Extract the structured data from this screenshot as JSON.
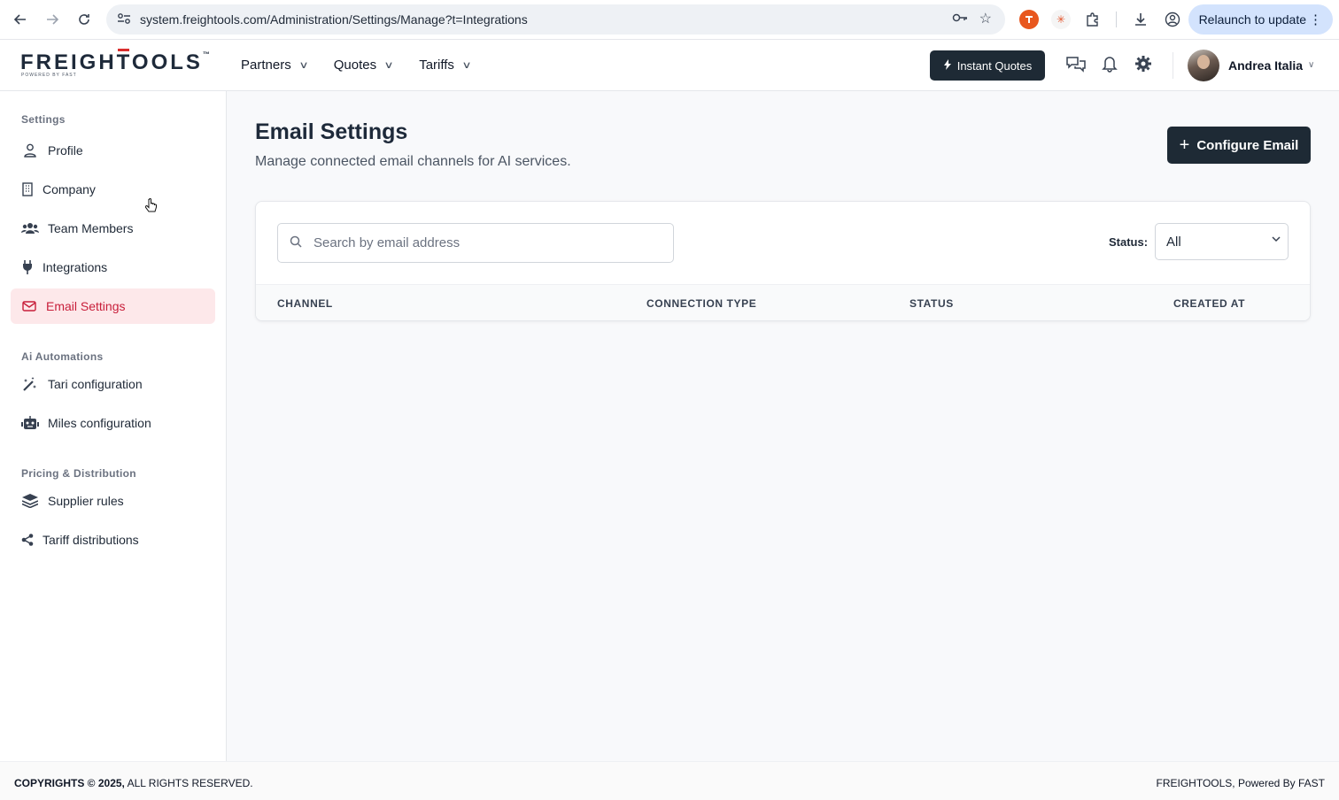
{
  "browser": {
    "url": "system.freightools.com/Administration/Settings/Manage?t=Integrations",
    "relaunch_label": "Relaunch to update"
  },
  "header": {
    "logo_text_a": "FREIGH",
    "logo_text_t": "T",
    "logo_text_b": "OOLS",
    "logo_tm": "™",
    "logo_powered": "POWERED BY FAST",
    "nav": [
      {
        "label": "Partners"
      },
      {
        "label": "Quotes"
      },
      {
        "label": "Tariffs"
      }
    ],
    "instant_quotes_label": "Instant Quotes",
    "user_name": "Andrea Italia"
  },
  "sidebar": {
    "sections": [
      {
        "title": "Settings"
      },
      {
        "title": "Ai Automations"
      },
      {
        "title": "Pricing & Distribution"
      }
    ],
    "items": [
      {
        "label": "Profile",
        "icon": "user-icon"
      },
      {
        "label": "Company",
        "icon": "building-icon"
      },
      {
        "label": "Team Members",
        "icon": "users-icon"
      },
      {
        "label": "Integrations",
        "icon": "plug-icon"
      },
      {
        "label": "Email Settings",
        "icon": "envelope-icon",
        "active": true
      },
      {
        "label": "Tari configuration",
        "icon": "magic-wand-icon"
      },
      {
        "label": "Miles configuration",
        "icon": "robot-icon"
      },
      {
        "label": "Supplier rules",
        "icon": "layers-icon"
      },
      {
        "label": "Tariff distributions",
        "icon": "share-icon"
      }
    ]
  },
  "main": {
    "title": "Email Settings",
    "subtitle": "Manage connected email channels for AI services.",
    "configure_label": "Configure Email",
    "search_placeholder": "Search by email address",
    "status_label": "Status:",
    "status_value": "All",
    "columns": [
      "CHANNEL",
      "CONNECTION TYPE",
      "STATUS",
      "CREATED AT"
    ]
  },
  "footer": {
    "copyright_bold": "COPYRIGHTS © 2025,",
    "copyright_rest": " ALL RIGHTS RESERVED.",
    "right_text": "FREIGHTOOLS, Powered By FAST"
  },
  "colors": {
    "accent": "#c81e3a",
    "active_bg": "#fde8ea",
    "dark_button": "#1e2a35"
  }
}
